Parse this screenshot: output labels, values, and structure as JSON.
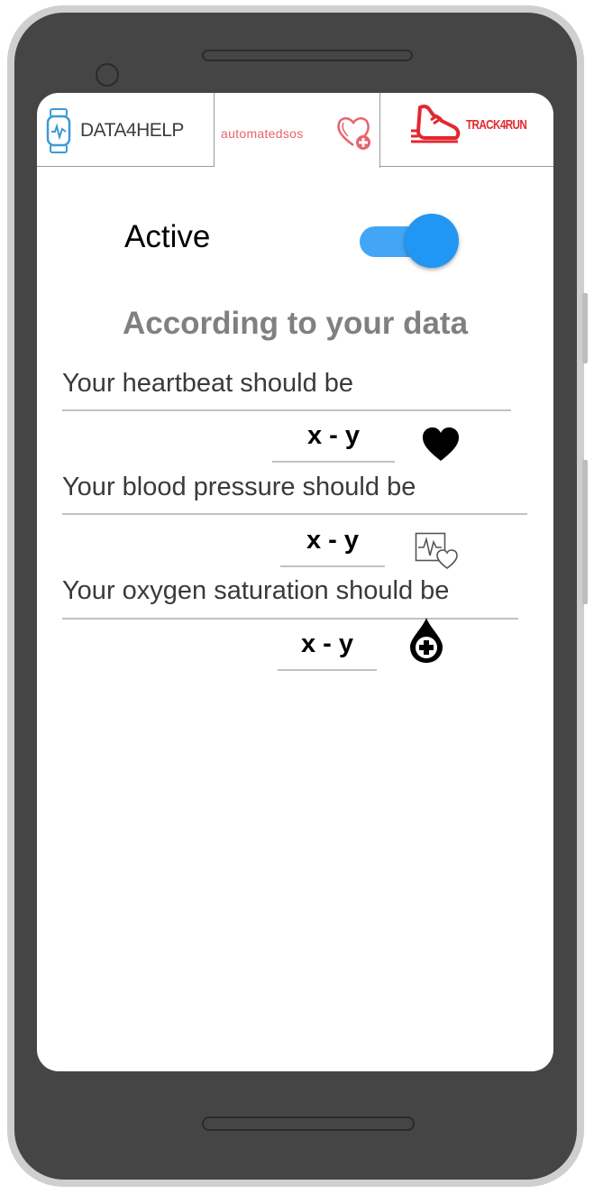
{
  "tabs": [
    {
      "label": "DATA4HELP",
      "icon": "smartwatch-icon"
    },
    {
      "label": "automatedsos",
      "icon": "heart-plus-icon"
    },
    {
      "label": "TRACK4RUN",
      "icon": "running-shoe-icon"
    }
  ],
  "active": {
    "label": "Active",
    "enabled": true
  },
  "heading": "According to your data",
  "metrics": [
    {
      "label": "Your heartbeat should be",
      "value": "x - y",
      "icon": "heart-icon"
    },
    {
      "label": "Your blood pressure should be",
      "value": "x - y",
      "icon": "pulse-monitor-icon"
    },
    {
      "label": "Your oxygen saturation should be",
      "value": "x - y",
      "icon": "blood-drop-plus-icon"
    }
  ],
  "colors": {
    "toggle_track": "#42a5f5",
    "toggle_knob": "#2196f3",
    "automatedsos": "#e8636b",
    "track4run": "#e3272f",
    "data4help_icon": "#3a9bd5"
  }
}
